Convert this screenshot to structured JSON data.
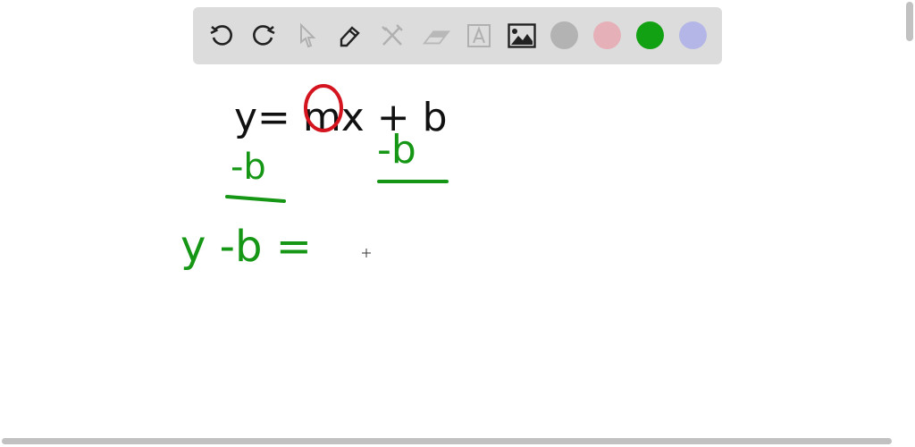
{
  "toolbar": {
    "tools": [
      "undo-icon",
      "redo-icon",
      "select-icon",
      "pen-icon",
      "tools-icon",
      "eraser-icon",
      "text-icon",
      "image-icon"
    ],
    "colors": {
      "gray": "#b3b3b3",
      "pink": "#e6b0b8",
      "green": "#12a112",
      "lavender": "#b3b6e6"
    }
  },
  "canvas": {
    "line1": "y= mx + b",
    "minus_b_left": "-b",
    "minus_b_right": "-b",
    "line3": "y -b ="
  }
}
